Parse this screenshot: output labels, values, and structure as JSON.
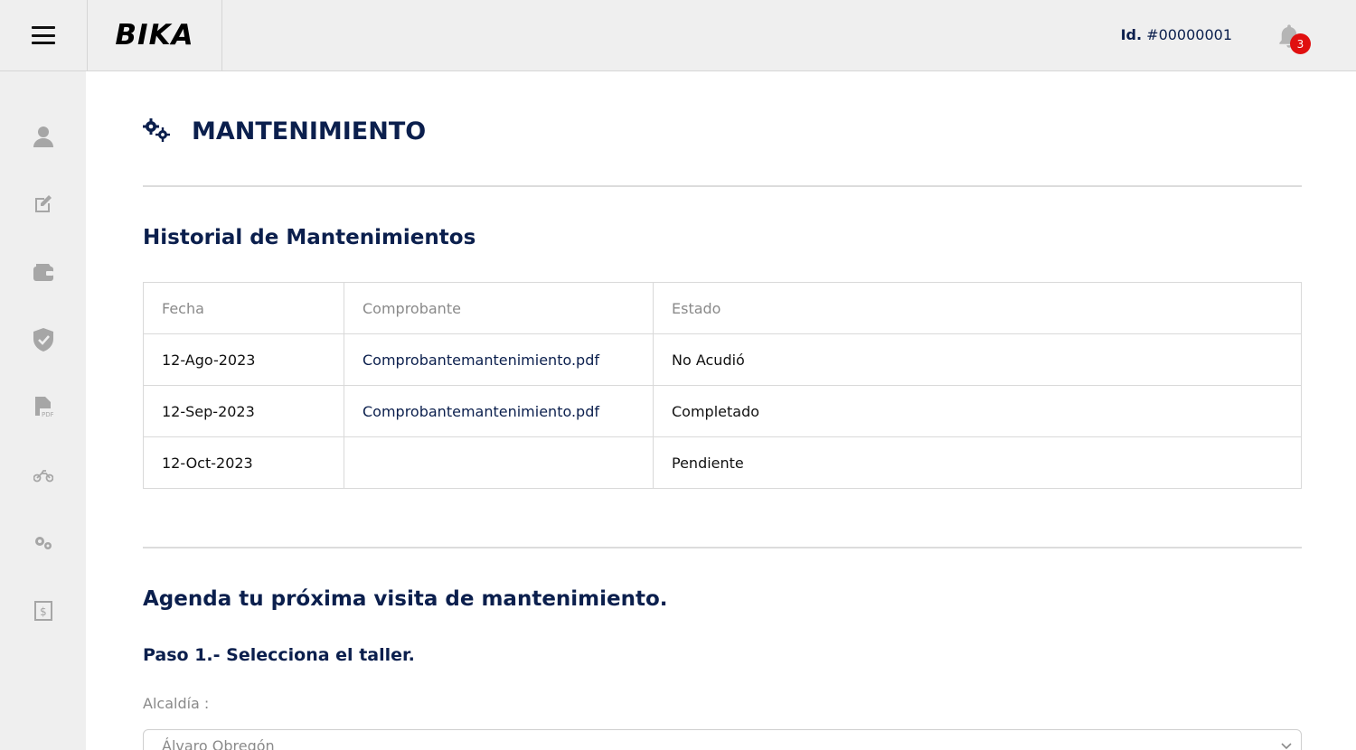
{
  "header": {
    "logo": "BIKA",
    "user_id_label": "Id.",
    "user_id_value": "#00000001",
    "notification_count": "3"
  },
  "sidebar": {
    "items": [
      {
        "icon": "user-icon"
      },
      {
        "icon": "edit-icon"
      },
      {
        "icon": "wallet-icon"
      },
      {
        "icon": "shield-check-icon"
      },
      {
        "icon": "pdf-file-icon"
      },
      {
        "icon": "motorcycle-icon"
      },
      {
        "icon": "gears-icon"
      },
      {
        "icon": "receipt-dollar-icon"
      }
    ]
  },
  "main": {
    "page_title": "MANTENIMIENTO",
    "history_title": "Historial de Mantenimientos",
    "table": {
      "headers": [
        "Fecha",
        "Comprobante",
        "Estado"
      ],
      "rows": [
        {
          "fecha": "12-Ago-2023",
          "comprobante": "Comprobantemantenimiento.pdf",
          "estado": "No Acudió"
        },
        {
          "fecha": "12-Sep-2023",
          "comprobante": "Comprobantemantenimiento.pdf",
          "estado": "Completado"
        },
        {
          "fecha": "12-Oct-2023",
          "comprobante": "",
          "estado": "Pendiente"
        }
      ]
    },
    "schedule_title": "Agenda tu próxima visita de mantenimiento.",
    "step1_title": "Paso 1.- Selecciona el taller.",
    "alcaldia_label": "Alcaldía :",
    "alcaldia_value": "Álvaro Obregón"
  },
  "colors": {
    "navy": "#0b1f4d",
    "status_red": "#e01010",
    "status_blue": "#1a3a9a",
    "status_yellow": "#e0b000",
    "sidebar_bg": "#efefef"
  }
}
